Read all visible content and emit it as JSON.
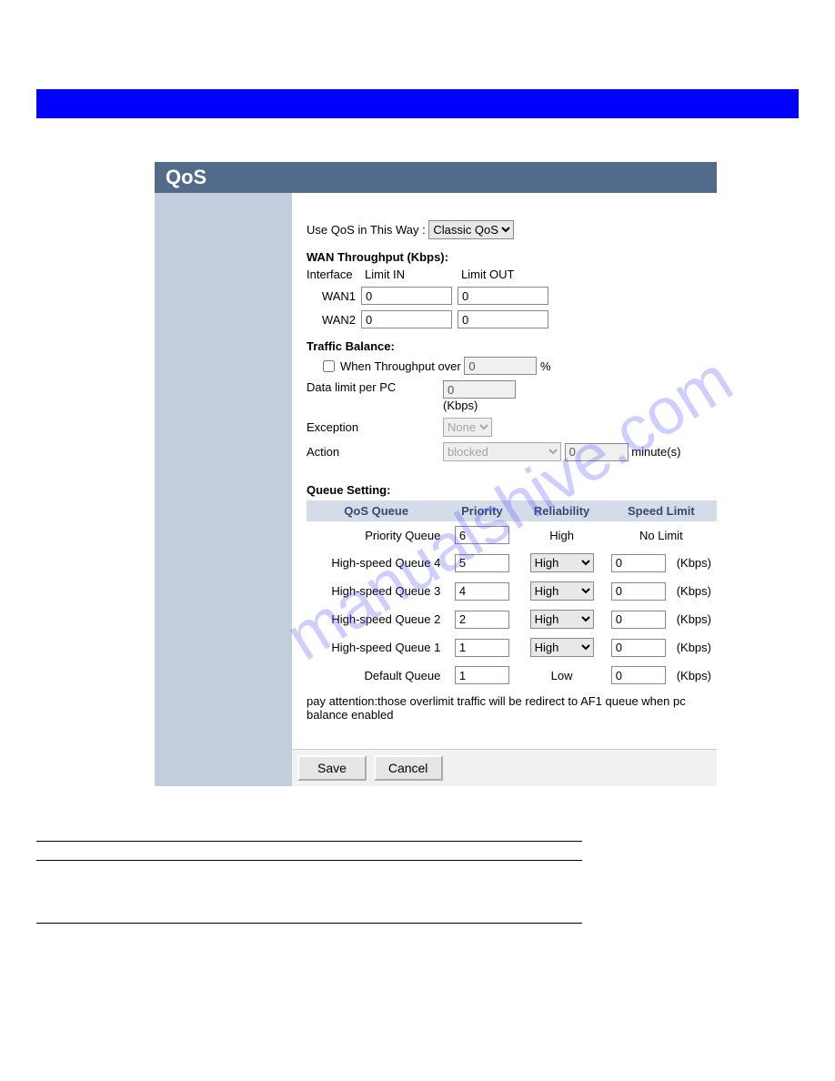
{
  "watermark": "manualshive.com",
  "panel": {
    "title": "QoS"
  },
  "useQos": {
    "label": "Use QoS in This Way :",
    "selected": "Classic QoS"
  },
  "wan": {
    "heading": "WAN Throughput (Kbps):",
    "col_iface": "Interface",
    "col_in": "Limit IN",
    "col_out": "Limit OUT",
    "rows": [
      {
        "iface": "WAN1",
        "in": "0",
        "out": "0"
      },
      {
        "iface": "WAN2",
        "in": "0",
        "out": "0"
      }
    ]
  },
  "traffic": {
    "heading": "Traffic Balance:",
    "when_label": "When Throughput over",
    "when_val": "0",
    "when_unit": "%",
    "datalimit_label": "Data limit per PC",
    "datalimit_val": "0",
    "datalimit_unit": "(Kbps)",
    "exception_label": "Exception",
    "exception_sel": "None",
    "action_label": "Action",
    "action_sel": "blocked",
    "action_min": "0",
    "action_unit": "minute(s)"
  },
  "queue": {
    "heading": "Queue Setting:",
    "headers": {
      "q": "QoS Queue",
      "pri": "Priority",
      "rel": "Reliability",
      "sl": "Speed Limit"
    },
    "kbps": "(Kbps)",
    "rows": [
      {
        "name": "Priority Queue",
        "pri": "6",
        "rel_fixed": "High",
        "sl_fixed": "No Limit"
      },
      {
        "name": "High-speed Queue 4",
        "pri": "5",
        "rel_sel": "High",
        "sl": "0"
      },
      {
        "name": "High-speed Queue 3",
        "pri": "4",
        "rel_sel": "High",
        "sl": "0"
      },
      {
        "name": "High-speed Queue 2",
        "pri": "2",
        "rel_sel": "High",
        "sl": "0"
      },
      {
        "name": "High-speed Queue 1",
        "pri": "1",
        "rel_sel": "High",
        "sl": "0"
      },
      {
        "name": "Default Queue",
        "pri": "1",
        "rel_fixed": "Low",
        "sl": "0"
      }
    ],
    "note": "pay attention:those overlimit traffic will be redirect to AF1 queue when pc balance enabled"
  },
  "buttons": {
    "save": "Save",
    "cancel": "Cancel"
  },
  "desc": {
    "c1": "",
    "c2": ""
  }
}
